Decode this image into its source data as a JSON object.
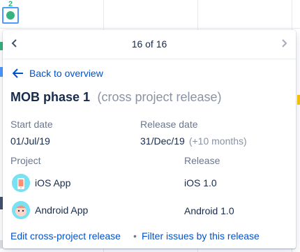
{
  "marker": {
    "count": "2"
  },
  "pager": {
    "label": "16 of 16"
  },
  "back": {
    "label": "Back to overview"
  },
  "release": {
    "name": "MOB phase 1",
    "type": "(cross project release)",
    "start_date_label": "Start date",
    "start_date": "01/Jul/19",
    "release_date_label": "Release date",
    "release_date": "31/Dec/19",
    "release_delta": "(+10 months)"
  },
  "table": {
    "col_project": "Project",
    "col_release": "Release",
    "rows": [
      {
        "project": "iOS App",
        "release": "iOS 1.0",
        "icon": "ios-app-avatar-icon"
      },
      {
        "project": "Android App",
        "release": "Android 1.0",
        "icon": "android-app-avatar-icon"
      }
    ]
  },
  "footer": {
    "edit_link": "Edit cross-project release",
    "separator": "•",
    "filter_link": "Filter issues by this release"
  },
  "colors": {
    "link": "#0052cc",
    "text": "#172b4d",
    "muted": "#6b778c",
    "marker_green": "#36b37e",
    "marker_border": "#4c9aff"
  }
}
